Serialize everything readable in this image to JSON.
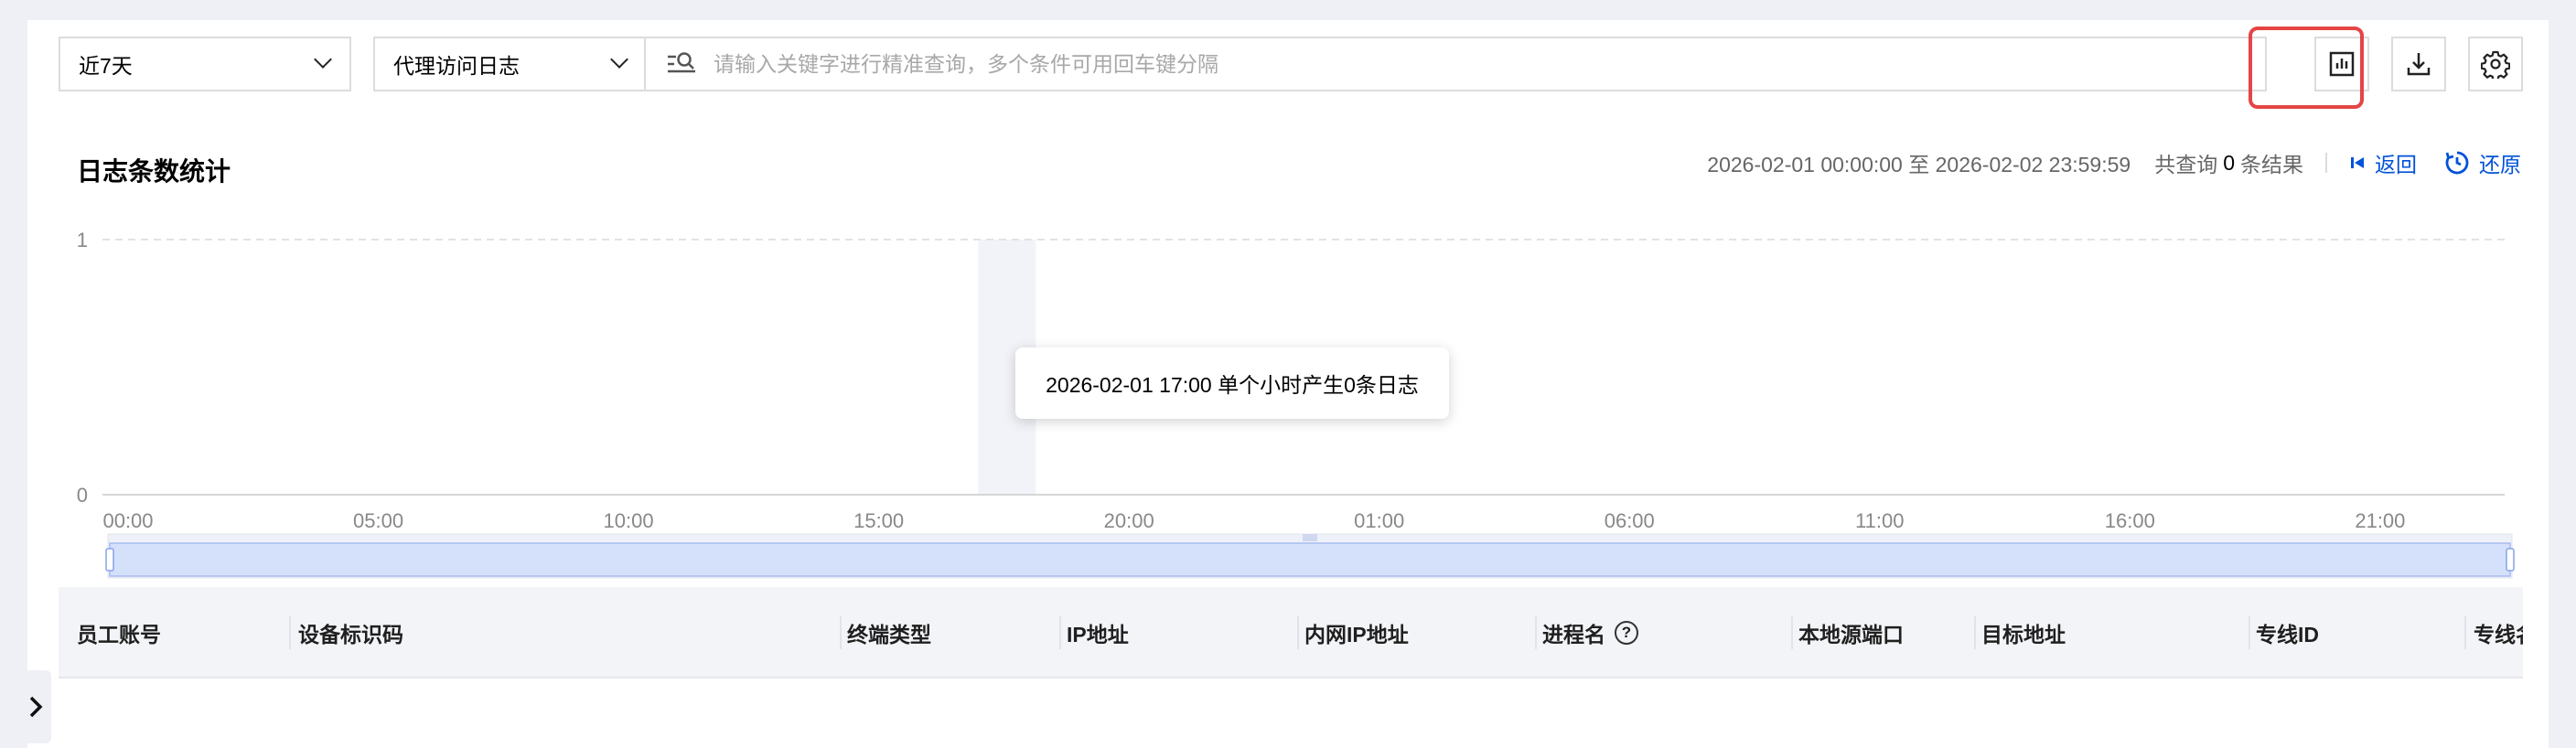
{
  "toolbar": {
    "time_range": "近7天",
    "log_type": "代理访问日志",
    "search_placeholder": "请输入关键字进行精准查询，多个条件可用回车键分隔",
    "icons": [
      "search-filter-icon",
      "bar-chart-icon",
      "download-icon",
      "gear-icon"
    ]
  },
  "stats": {
    "title": "日志条数统计",
    "time_span": "2026-02-01 00:00:00 至 2026-02-02 23:59:59",
    "result_prefix": "共查询",
    "result_count": "0",
    "result_suffix": "条结果",
    "back_label": "返回",
    "reset_label": "还原"
  },
  "chart_data": {
    "type": "bar",
    "y_ticks": [
      "1",
      "0"
    ],
    "ylim": [
      0,
      1
    ],
    "x_ticks": [
      "00:00",
      "05:00",
      "10:00",
      "15:00",
      "20:00",
      "01:00",
      "06:00",
      "11:00",
      "16:00",
      "21:00"
    ],
    "values": [],
    "grid": true,
    "highlighted_hour": "2026-02-01 17:00",
    "tooltip": "2026-02-01 17:00 单个小时产生0条日志",
    "zoom_range": [
      0,
      100
    ]
  },
  "table": {
    "columns": [
      "员工账号",
      "设备标识码",
      "终端类型",
      "IP地址",
      "内网IP地址",
      "进程名",
      "本地源端口",
      "目标地址",
      "专线ID",
      "专线名"
    ]
  },
  "colors": {
    "highlight": "#e54545",
    "link": "#0052d9",
    "zoom_fill": "#d5e0fb"
  }
}
